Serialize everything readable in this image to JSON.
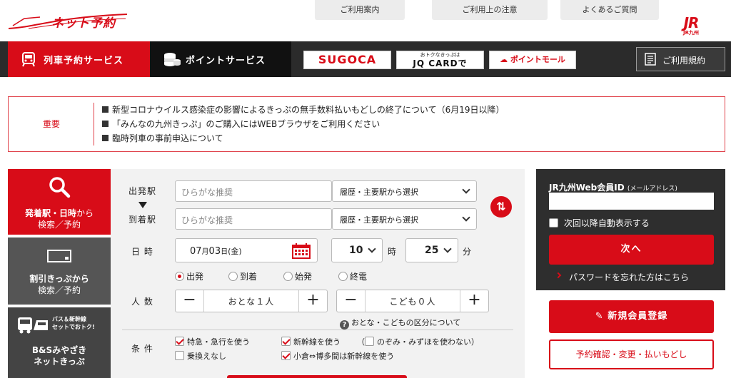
{
  "brand": {
    "logo_text": "ネット予約",
    "jr_mark": "JR",
    "jr_sub": "JR九州"
  },
  "util_links": [
    "ご利用案内",
    "ご利用上の注意",
    "よくあるご質問"
  ],
  "nav": {
    "train_label": "列車予約サービス",
    "point_label": "ポイントサービス",
    "sugoca": "SUGOCA",
    "jq_small": "おトクなきっぷは",
    "jq_big": "JQ CARDで",
    "mall": "ポイントモール",
    "terms": "ご利用規約"
  },
  "notice": {
    "heading": "重要",
    "items": [
      "新型コロナウイルス感染症の影響によるきっぷの無手数料払いもどしの終了について（6月19日以降）",
      "「みんなの九州きっぷ」のご購入にはWEBブラウザをご利用ください",
      "臨時列車の事前申込について"
    ]
  },
  "side_tabs": {
    "t1_a": "発着駅・日時",
    "t1_b": "から",
    "t1_c": "検索／予約",
    "t2_a": "割引きっぷから",
    "t2_b": "検索／予約",
    "t3_badge_a": "バス＆新幹線",
    "t3_badge_b": "セットでおトク!",
    "t3_a": "B&Sみやざき",
    "t3_b": "ネットきっぷ"
  },
  "form": {
    "from_label": "出発駅",
    "to_label": "到着駅",
    "station_placeholder": "ひらがな推奨",
    "history_select": "履歴・主要駅から選択",
    "date_label": "日 時",
    "date_month": "07",
    "date_day": "03",
    "date_weekday": "金",
    "month_suffix": "月",
    "day_suffix": "日",
    "hour": "10",
    "hour_unit": "時",
    "minute": "25",
    "minute_unit": "分",
    "radio": [
      "出発",
      "到着",
      "始発",
      "終電"
    ],
    "people_label": "人 数",
    "adult": "おとな１人",
    "child": "こども０人",
    "help": "おとな・こどもの区分について",
    "conditions_label": "条 件",
    "conditions": {
      "express": "特急・急行を使う",
      "no_transfer": "乗換えなし",
      "shinkansen": "新幹線を使う",
      "nozomi": "のぞみ・みずほを使わない）",
      "nozomi_open": "（",
      "kokura": "小倉⇔博多間は新幹線を使う"
    }
  },
  "login": {
    "id_label": "JR九州Web会員ID",
    "id_sub": "(メールアドレス)",
    "auto_label": "次回以降自動表示する",
    "next": "次へ",
    "forgot": "パスワードを忘れた方はこちら",
    "register": "新規会員登録",
    "reservation": "予約確認・変更・払いもどし"
  },
  "colors": {
    "brand_red": "#d80c18",
    "dark": "#2b2b2b"
  }
}
